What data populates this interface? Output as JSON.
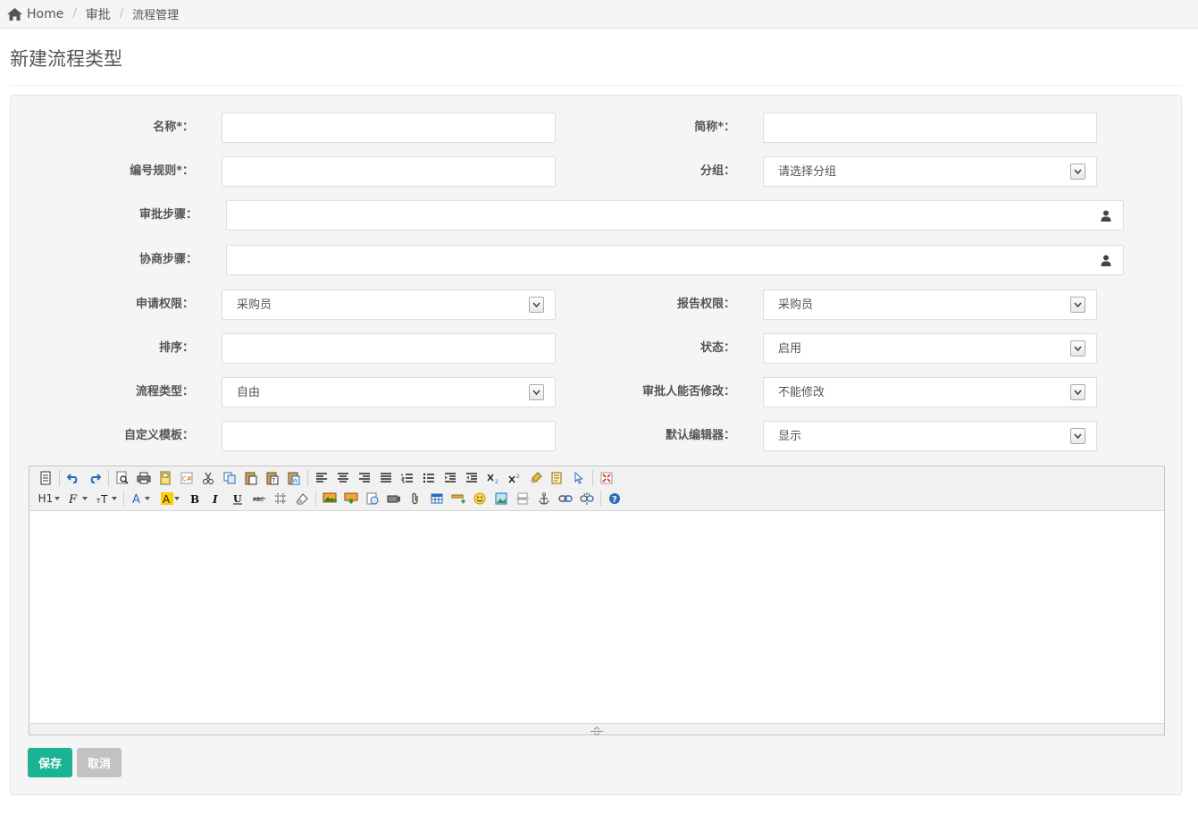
{
  "breadcrumb": {
    "home": "Home",
    "level2": "审批",
    "current": "流程管理"
  },
  "page": {
    "title": "新建流程类型"
  },
  "form": {
    "name_label": "名称*：",
    "short_label": "简称*：",
    "code_label": "编号规则*：",
    "group_label": "分组：",
    "group_value": "请选择分组",
    "approve_steps_label": "审批步骤：",
    "consult_steps_label": "协商步骤：",
    "apply_perm_label": "申请权限：",
    "apply_perm_value": "采购员",
    "report_perm_label": "报告权限：",
    "report_perm_value": "采购员",
    "sort_label": "排序：",
    "status_label": "状态：",
    "status_value": "启用",
    "flow_type_label": "流程类型：",
    "flow_type_value": "自由",
    "approver_edit_label": "审批人能否修改：",
    "approver_edit_value": "不能修改",
    "custom_template_label": "自定义模板：",
    "default_editor_label": "默认编辑器：",
    "default_editor_value": "显示"
  },
  "editor": {
    "heading_btn": "H1",
    "colors": {
      "accent": "#1ab394",
      "highlight": "#ffcc00",
      "font_color": "#3366cc"
    }
  },
  "actions": {
    "save": "保存",
    "cancel": "取消"
  }
}
